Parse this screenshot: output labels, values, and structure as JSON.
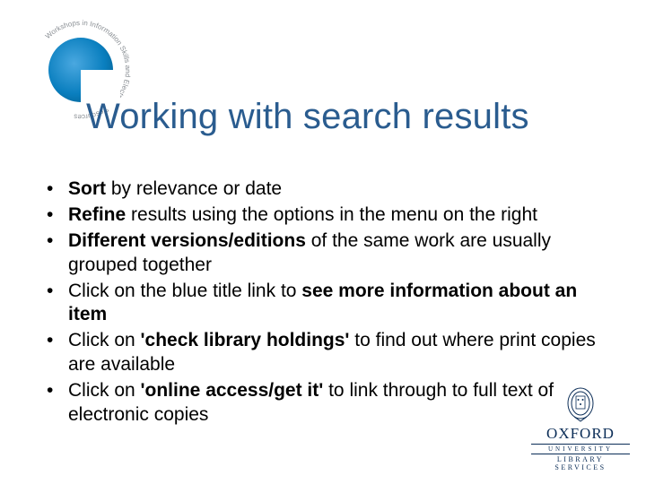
{
  "logo": {
    "ring_text": "Workshops in Information Skills and Electronic Resources"
  },
  "title": "Working with search results",
  "bullets": [
    {
      "lead_bold": "Sort",
      "rest": " by relevance or date"
    },
    {
      "lead_bold": "Refine",
      "rest": " results using the options in the menu on the right"
    },
    {
      "lead_bold": "Different versions/editions",
      "rest": " of the same work are usually grouped together"
    },
    {
      "pre": "Click on the blue title link to ",
      "mid_bold": "see more information about an item",
      "post": ""
    },
    {
      "pre": "Click on ",
      "mid_bold": "'check library holdings'",
      "post": " to find out where print copies are available"
    },
    {
      "pre": "Click on ",
      "mid_bold": "'online access/get it'",
      "post": " to link through to full text of electronic copies"
    }
  ],
  "footer": {
    "word": "OXFORD",
    "line1": "UNIVERSITY",
    "line2": "LIBRARY",
    "line3": "SERVICES"
  }
}
